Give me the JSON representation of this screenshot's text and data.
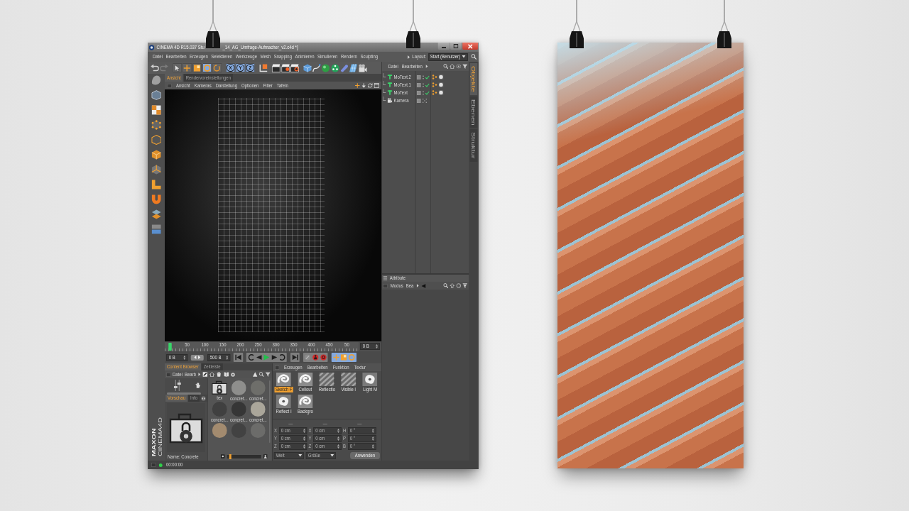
{
  "window": {
    "title_start": "CINEMA 4D R15.037 Stu",
    "title_end": "_14_AG_Umfrage-Aufmacher_v2.c4d *]"
  },
  "menu": [
    "Datei",
    "Bearbeiten",
    "Erzeugen",
    "Selektieren",
    "Werkzeuge",
    "Mesh",
    "Snapping",
    "Animieren",
    "Simulieren",
    "Rendern",
    "Sculpting"
  ],
  "layout": {
    "label": "Layout:",
    "value": "Start (Benutzer)"
  },
  "toolbar": {
    "tools": [
      {
        "selected": false
      },
      {
        "selected": false
      },
      {
        "selected": false
      },
      {
        "selected": true
      },
      {
        "selected": false
      }
    ],
    "axes": [
      {
        "label": "X",
        "on": true
      },
      {
        "label": "Y",
        "on": true
      },
      {
        "label": "Z",
        "on": true
      }
    ]
  },
  "viewport": {
    "tabs": [
      {
        "label": "Ansicht",
        "selected": true
      },
      {
        "label": "Rendervoreinstellungen",
        "selected": false
      }
    ],
    "menu": [
      "Ansicht",
      "Kameras",
      "Darstellung",
      "Optionen",
      "Filter",
      "Tafeln"
    ]
  },
  "timeline": {
    "ticks": [
      "50",
      "100",
      "150",
      "200",
      "250",
      "300",
      "350",
      "400",
      "450",
      "50"
    ],
    "frame": "0 B"
  },
  "transport": {
    "start": "0 B",
    "end": "500 B"
  },
  "objects": {
    "menu": [
      "Datei",
      "Bearbeiten"
    ],
    "items": [
      {
        "name": "MoText.2",
        "kind": "text"
      },
      {
        "name": "MoText.1",
        "kind": "text"
      },
      {
        "name": "MoText",
        "kind": "text"
      },
      {
        "name": "Kamera",
        "kind": "camera"
      }
    ],
    "side_tabs": [
      {
        "label": "Objekte",
        "selected": true
      },
      {
        "label": "Ebenen",
        "selected": false
      },
      {
        "label": "Struktur",
        "selected": false
      }
    ]
  },
  "attributes": {
    "title": "Attribute",
    "menu": [
      "Modus",
      "Bea"
    ]
  },
  "content_browser": {
    "tabs": [
      {
        "label": "Content Browser",
        "selected": true
      },
      {
        "label": "Zeitleiste",
        "selected": false
      }
    ],
    "menu": [
      "Datei",
      "Bearb"
    ],
    "preview_tabs": [
      {
        "label": "Vorschau",
        "selected": true
      },
      {
        "label": "Info",
        "selected": false
      }
    ],
    "name": "Name: Concrete",
    "items": [
      {
        "label": "tex",
        "kind": "folder"
      },
      {
        "label": "concret...",
        "kind": "material",
        "color": "#8e8e8c"
      },
      {
        "label": "concret...",
        "kind": "material",
        "color": "#6e6e6a"
      },
      {
        "label": "concret...",
        "kind": "material",
        "color": "#404040"
      },
      {
        "label": "concret...",
        "kind": "material",
        "color": "#363636"
      },
      {
        "label": "concret...",
        "kind": "material",
        "color": "#aaa69a"
      },
      {
        "kind": "material",
        "color": "#a38b6f"
      },
      {
        "kind": "material",
        "color": "#424242"
      },
      {
        "kind": "material",
        "color": "#6c6c6a"
      }
    ],
    "zoom": {
      "level": 0.06
    }
  },
  "materials": {
    "menu": [
      "Erzeugen",
      "Bearbeiten",
      "Funktion",
      "Textur"
    ],
    "items": [
      {
        "label": "Sketch F",
        "kind": "swirl",
        "selected": true
      },
      {
        "label": "Cellout",
        "kind": "swirl",
        "selected": false
      },
      {
        "label": "Reflectio",
        "kind": "striped",
        "selected": false
      },
      {
        "label": "Visible l",
        "kind": "striped",
        "selected": false
      },
      {
        "label": "Light M",
        "kind": "blob",
        "selected": false
      },
      {
        "label": "Reflect I",
        "kind": "blob",
        "selected": false
      },
      {
        "label": "Backgro",
        "kind": "swirl",
        "selected": false
      }
    ]
  },
  "coordinates": {
    "disabled": true,
    "headers": [
      "—",
      "—",
      "—"
    ],
    "rows": [
      [
        {
          "axis": "X",
          "value": "0 cm"
        },
        {
          "axis": "X",
          "value": "0 cm"
        },
        {
          "axis": "H",
          "value": "0 °"
        }
      ],
      [
        {
          "axis": "Y",
          "value": "0 cm"
        },
        {
          "axis": "Y",
          "value": "0 cm"
        },
        {
          "axis": "P",
          "value": "0 °"
        }
      ],
      [
        {
          "axis": "Z",
          "value": "0 cm"
        },
        {
          "axis": "Z",
          "value": "0 cm"
        },
        {
          "axis": "B",
          "value": "0 °"
        }
      ]
    ],
    "modes": [
      "Welt",
      "Größe"
    ],
    "apply": "Anwenden"
  },
  "logo": {
    "brand": "MAXON",
    "product": "CINEMA4D"
  },
  "status": {
    "time": "00:00:00"
  }
}
